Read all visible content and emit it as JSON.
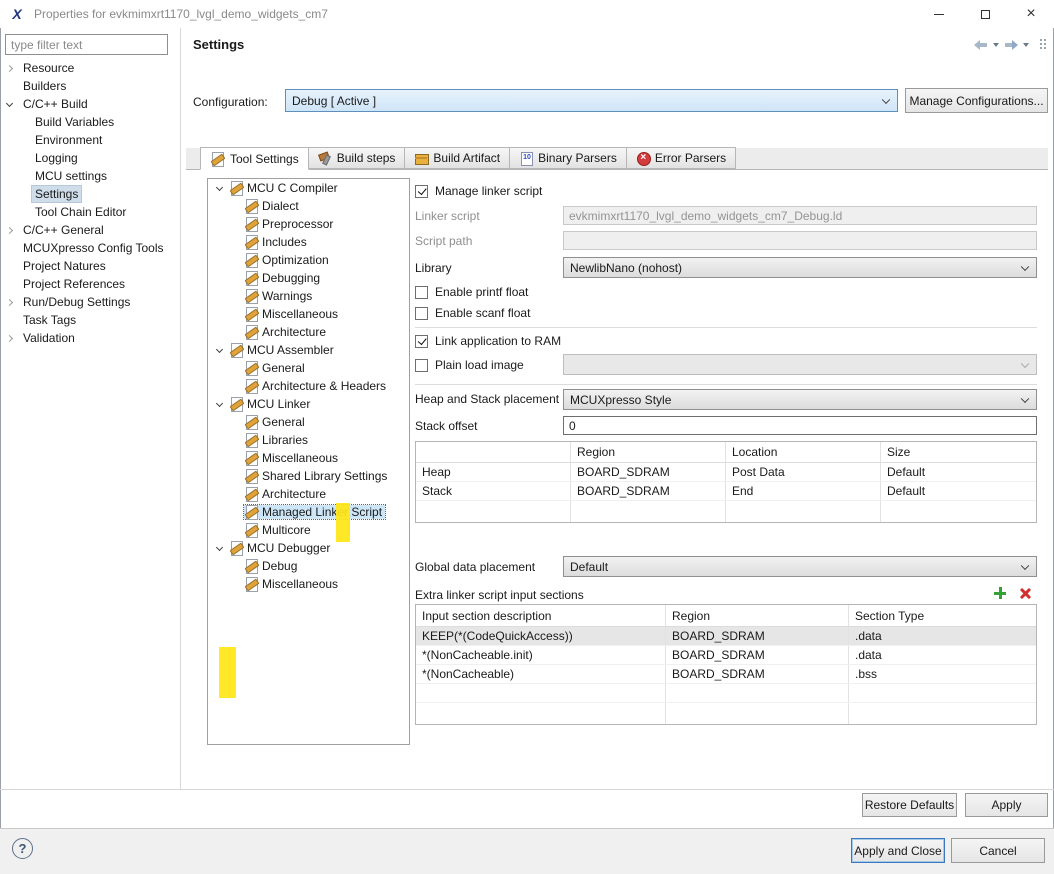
{
  "window": {
    "title": "Properties for evkmimxrt1170_lvgl_demo_widgets_cm7"
  },
  "sidebar": {
    "filter_placeholder": "type filter text",
    "items": [
      "Resource",
      "Builders",
      "C/C++ Build",
      "Build Variables",
      "Environment",
      "Logging",
      "MCU settings",
      "Settings",
      "Tool Chain Editor",
      "C/C++ General",
      "MCUXpresso Config Tools",
      "Project Natures",
      "Project References",
      "Run/Debug Settings",
      "Task Tags",
      "Validation"
    ]
  },
  "header": {
    "title": "Settings"
  },
  "configuration": {
    "label": "Configuration:",
    "value": "Debug [ Active ]",
    "manage_button": "Manage Configurations..."
  },
  "tabs": {
    "tool_settings": "Tool Settings",
    "build_steps": "Build steps",
    "build_artifact": "Build Artifact",
    "binary_parsers": "Binary Parsers",
    "error_parsers": "Error Parsers"
  },
  "tool_tree": [
    "MCU C Compiler",
    "Dialect",
    "Preprocessor",
    "Includes",
    "Optimization",
    "Debugging",
    "Warnings",
    "Miscellaneous",
    "Architecture",
    "MCU Assembler",
    "General",
    "Architecture & Headers",
    "MCU Linker",
    "General",
    "Libraries",
    "Miscellaneous",
    "Shared Library Settings",
    "Architecture",
    "Managed Linker Script",
    "Multicore",
    "MCU Debugger",
    "Debug",
    "Miscellaneous"
  ],
  "form": {
    "manage_linker_script": "Manage linker script",
    "linker_script_label": "Linker script",
    "linker_script_value": "evkmimxrt1170_lvgl_demo_widgets_cm7_Debug.ld",
    "script_path_label": "Script path",
    "script_path_value": "",
    "library_label": "Library",
    "library_value": "NewlibNano (nohost)",
    "enable_printf_float": "Enable printf float",
    "enable_scanf_float": "Enable scanf float",
    "link_application_to_ram": "Link application to RAM",
    "plain_load_image": "Plain load image",
    "plain_load_image_value": "",
    "heap_stack_placement_label": "Heap and Stack placement",
    "heap_stack_placement_value": "MCUXpresso Style",
    "stack_offset_label": "Stack offset",
    "stack_offset_value": "0",
    "heap_stack_table": {
      "headers": [
        "",
        "Region",
        "Location",
        "Size"
      ],
      "rows": [
        [
          "Heap",
          "BOARD_SDRAM",
          "Post Data",
          "Default"
        ],
        [
          "Stack",
          "BOARD_SDRAM",
          "End",
          "Default"
        ]
      ]
    },
    "global_data_placement_label": "Global data placement",
    "global_data_placement_value": "Default",
    "extra_sections_label": "Extra linker script input sections",
    "extra_sections_table": {
      "headers": [
        "Input section description",
        "Region",
        "Section Type"
      ],
      "rows": [
        [
          "KEEP(*(CodeQuickAccess))",
          "BOARD_SDRAM",
          ".data"
        ],
        [
          "*(NonCacheable.init)",
          "BOARD_SDRAM",
          ".data"
        ],
        [
          "*(NonCacheable)",
          "BOARD_SDRAM",
          ".bss"
        ]
      ]
    }
  },
  "page_buttons": {
    "restore_defaults": "Restore Defaults",
    "apply": "Apply"
  },
  "footer": {
    "help": "?",
    "apply_and_close": "Apply and Close",
    "cancel": "Cancel"
  }
}
